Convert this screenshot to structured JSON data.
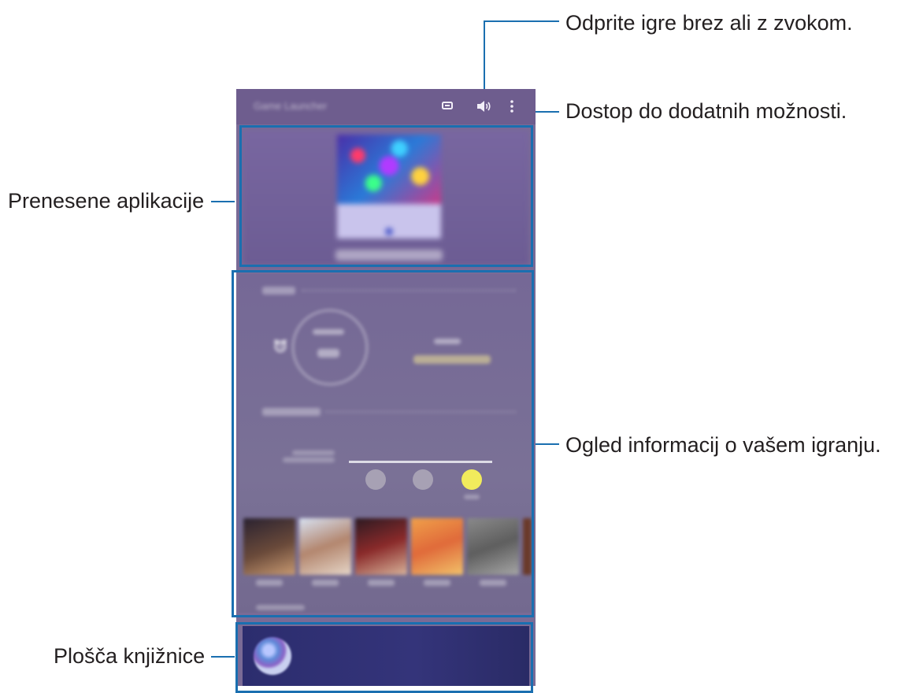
{
  "callouts": {
    "sound": "Odprite igre brez ali z zvokom.",
    "more_options": "Dostop do dodatnih možnosti.",
    "downloaded_apps": "Prenesene aplikacije",
    "play_info": "Ogled informacij o vašem igranju.",
    "library_panel": "Plošča knjižnice"
  },
  "topbar": {
    "title": "Game Launcher",
    "icons": [
      "chat-icon",
      "sound-icon",
      "more-options-icon"
    ]
  },
  "play_info": {
    "sound_options": 3,
    "selected_option_index": 2
  },
  "colors": {
    "leader_line": "#1a6fb0",
    "phone_bg": "#7a6b96",
    "topbar_bg": "#6e5d8e",
    "selected_option": "#f1eb5c",
    "library_bg": "#2c2d6e"
  }
}
